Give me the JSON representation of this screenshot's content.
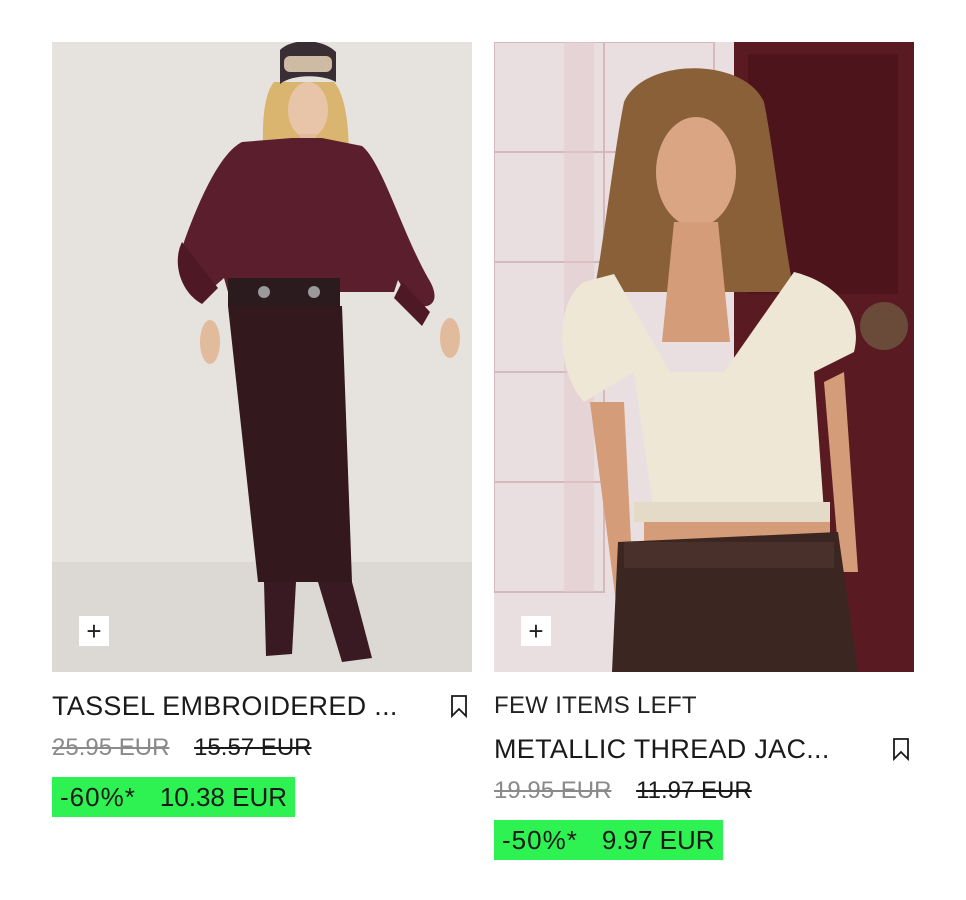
{
  "products": [
    {
      "title": "TASSEL EMBROIDERED ...",
      "original_price": "25.95 EUR",
      "previous_price": "15.57 EUR",
      "discount": "-60%*",
      "final_price": "10.38 EUR",
      "add_icon": "plus-icon",
      "save_icon": "bookmark-icon"
    },
    {
      "stock_note": "FEW ITEMS LEFT",
      "title": "METALLIC THREAD JAC...",
      "original_price": "19.95 EUR",
      "previous_price": "11.97 EUR",
      "discount": "-50%*",
      "final_price": "9.97 EUR",
      "add_icon": "plus-icon",
      "save_icon": "bookmark-icon"
    }
  ],
  "colors": {
    "sale_badge": "#2ef251",
    "strike_grey": "#8a8a8a",
    "text": "#1a1a1a"
  }
}
